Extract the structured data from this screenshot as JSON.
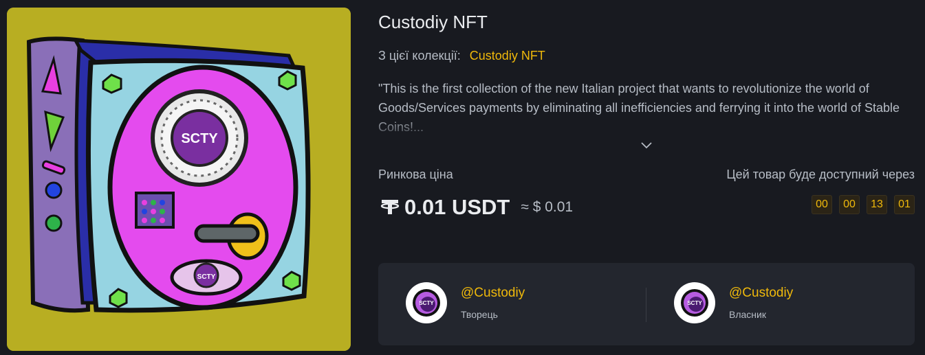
{
  "nft": {
    "title": "Custodiy NFT",
    "image_alt": "SCTY safe artwork",
    "logo_text": "SCTY"
  },
  "collection": {
    "label": "З цієї колекції:",
    "name": "Custodiy NFT"
  },
  "description": {
    "text": "\"This is the first collection of the new Italian project that wants to revolutionize the world of Goods/Services payments by eliminating all inefficiencies and ferrying it into the world of Stable Coins!..."
  },
  "price": {
    "label": "Ринкова ціна",
    "currency_icon": "tether-icon",
    "amount": "0.01 USDT",
    "approx": "≈ $ 0.01"
  },
  "availability": {
    "label": "Цей товар буде доступний через",
    "countdown": [
      "00",
      "00",
      "13",
      "01"
    ]
  },
  "creator": {
    "handle": "@Custodiy",
    "role": "Творець",
    "avatar_text": "SCTY"
  },
  "owner": {
    "handle": "@Custodiy",
    "role": "Власник",
    "avatar_text": "SCTY"
  },
  "colors": {
    "accent": "#F0B90B",
    "background": "#181A20",
    "card": "#23262E",
    "art_background": "#B8AE22"
  }
}
